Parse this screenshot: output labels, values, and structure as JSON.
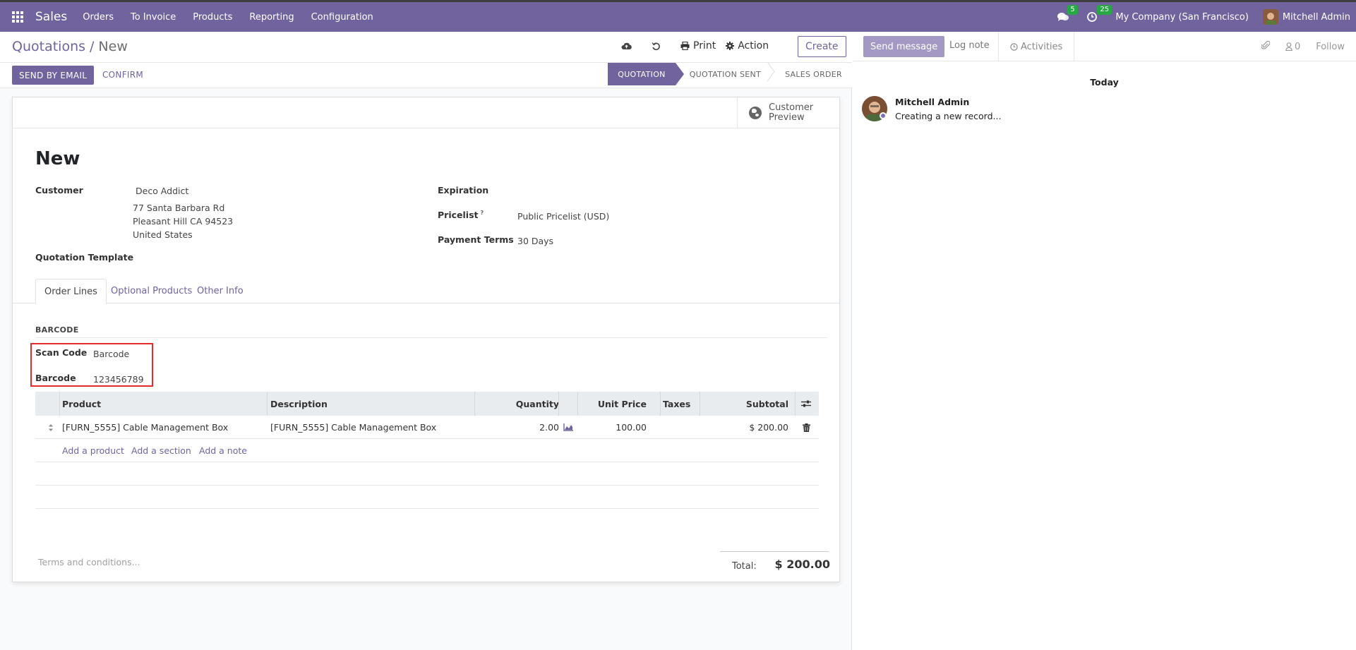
{
  "navbar": {
    "brand": "Sales",
    "menu": [
      "Orders",
      "To Invoice",
      "Products",
      "Reporting",
      "Configuration"
    ],
    "messages_count": "5",
    "activities_count": "25",
    "company": "My Company (San Francisco)",
    "user": "Mitchell Admin"
  },
  "control_panel": {
    "breadcrumb_parent": "Quotations",
    "breadcrumb_sep": "/",
    "breadcrumb_current": "New",
    "print_label": "Print",
    "action_label": "Action",
    "create_label": "Create"
  },
  "status_bar": {
    "send_email_label": "SEND BY EMAIL",
    "confirm_label": "CONFIRM",
    "stages": [
      "QUOTATION",
      "QUOTATION SENT",
      "SALES ORDER"
    ],
    "active_stage": "QUOTATION"
  },
  "sheet": {
    "preview_label_1": "Customer",
    "preview_label_2": "Preview",
    "title": "New",
    "customer_label": "Customer",
    "customer_name": "Deco Addict",
    "address_1": "77 Santa Barbara Rd",
    "address_2": "Pleasant Hill CA 94523",
    "address_3": "United States",
    "template_label": "Quotation Template",
    "expiration_label": "Expiration",
    "pricelist_label": "Pricelist",
    "pricelist_help": "?",
    "pricelist_value": "Public Pricelist (USD)",
    "payment_terms_label": "Payment Terms",
    "payment_terms_value": "30 Days"
  },
  "tabs": [
    "Order Lines",
    "Optional Products",
    "Other Info"
  ],
  "barcode": {
    "section_title": "BARCODE",
    "scan_code_label": "Scan Code",
    "scan_code_value": "Barcode",
    "barcode_label": "Barcode",
    "barcode_value": "123456789"
  },
  "table": {
    "headers": {
      "product": "Product",
      "description": "Description",
      "quantity": "Quantity",
      "unit_price": "Unit Price",
      "taxes": "Taxes",
      "subtotal": "Subtotal"
    },
    "rows": [
      {
        "product": "[FURN_5555] Cable Management Box",
        "description": "[FURN_5555] Cable Management Box",
        "quantity": "2.00",
        "unit_price": "100.00",
        "taxes": "",
        "subtotal": "$ 200.00"
      }
    ],
    "add_product": "Add a product",
    "add_section": "Add a section",
    "add_note": "Add a note"
  },
  "footer": {
    "terms_placeholder": "Terms and conditions...",
    "total_label": "Total:",
    "total_value": "$ 200.00"
  },
  "chatter": {
    "send_message": "Send message",
    "log_note": "Log note",
    "activities": "Activities",
    "followers_count": "0",
    "follow": "Follow",
    "date_separator": "Today",
    "messages": [
      {
        "author": "Mitchell Admin",
        "body": "Creating a new record..."
      }
    ]
  },
  "colors": {
    "brand": "#71639e",
    "highlight_box": "#e32b2b",
    "badge": "#28a745"
  }
}
